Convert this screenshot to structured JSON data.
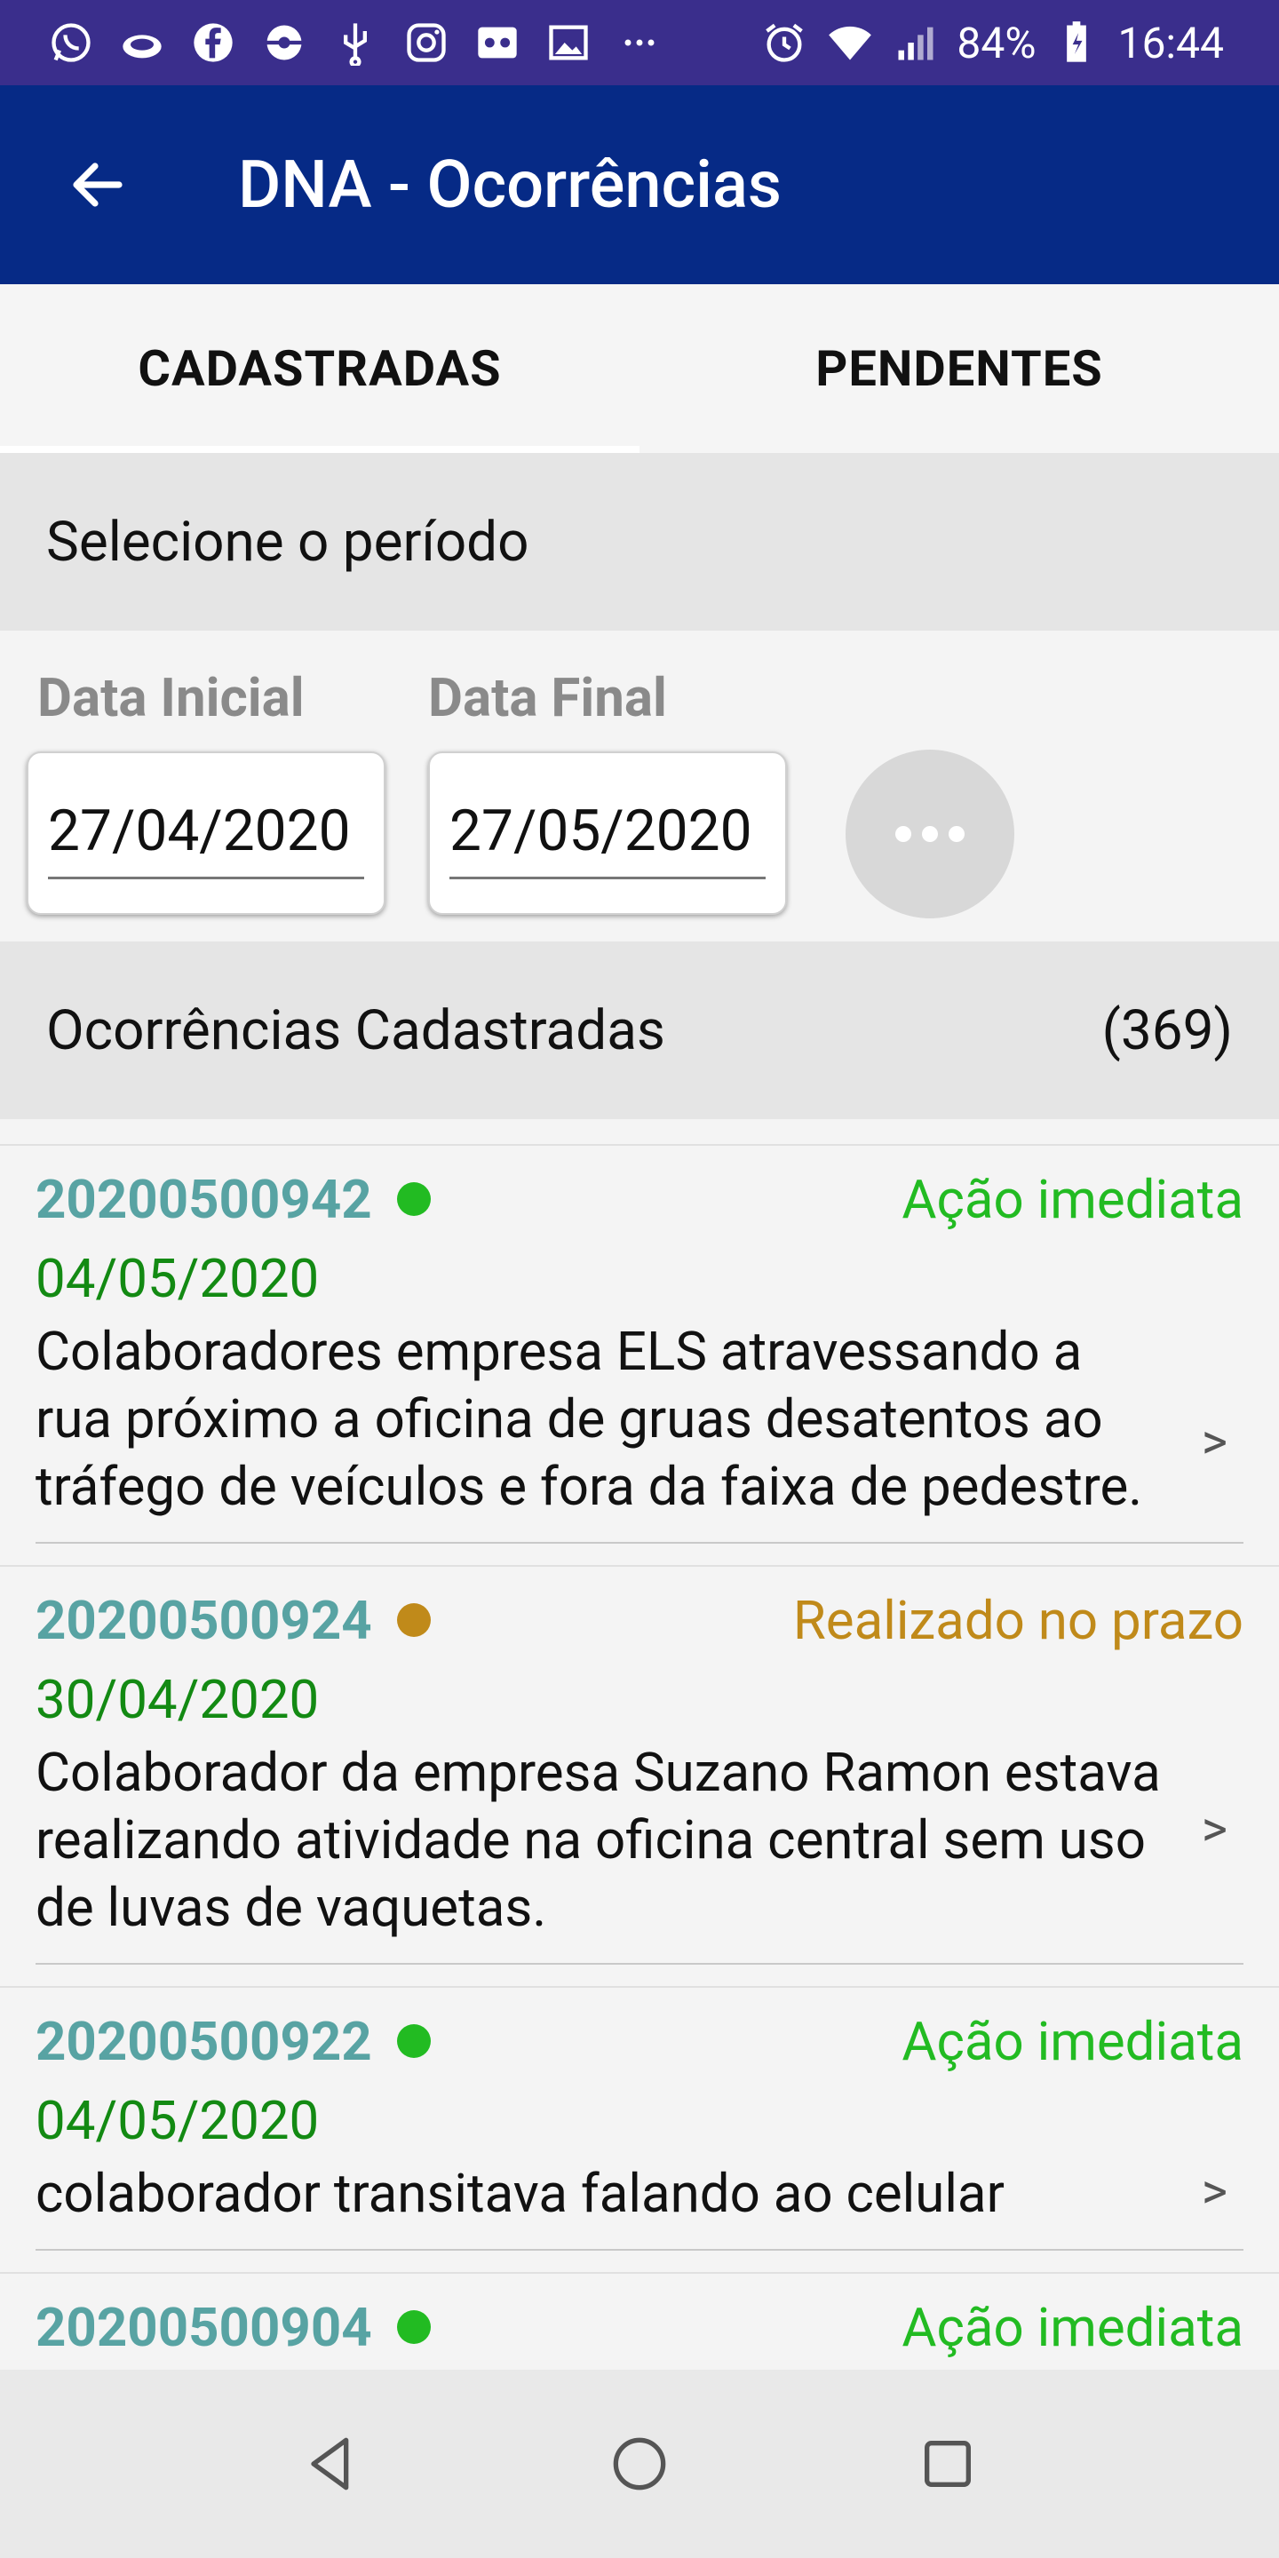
{
  "status_bar": {
    "battery": "84%",
    "time": "16:44",
    "icons_left": [
      "whatsapp-icon",
      "cloud-icon",
      "facebook-icon",
      "pokeball-icon",
      "usb-icon",
      "instagram-icon",
      "voicemail-icon",
      "gallery-icon",
      "more-dots-icon"
    ],
    "icons_right": [
      "alarm-icon",
      "wifi-icon",
      "signal-icon",
      "battery-icon"
    ]
  },
  "app_bar": {
    "title": "DNA - Ocorrências"
  },
  "tabs": [
    {
      "label": "CADASTRADAS",
      "active": true
    },
    {
      "label": "PENDENTES",
      "active": false
    }
  ],
  "period": {
    "header": "Selecione o período",
    "start_label": "Data Inicial",
    "start_value": "27/04/2020",
    "end_label": "Data Final",
    "end_value": "27/05/2020"
  },
  "occurrences": {
    "header": "Ocorrências Cadastradas",
    "count": "(369)",
    "items": [
      {
        "number": "20200500942",
        "status": "Ação imediata",
        "status_color": "#22bb22",
        "date": "04/05/2020",
        "description": "Colaboradores empresa ELS atravessando a rua próximo a oficina de gruas desatentos ao tráfego de veículos e fora da faixa de pedestre."
      },
      {
        "number": "20200500924",
        "status": "Realizado no prazo",
        "status_color": "#c08a1a",
        "date": "30/04/2020",
        "description": "Colaborador da empresa Suzano Ramon estava realizando atividade na oficina central sem uso de luvas de vaquetas."
      },
      {
        "number": "20200500922",
        "status": "Ação imediata",
        "status_color": "#22bb22",
        "date": "04/05/2020",
        "description": "colaborador transitava falando ao celular"
      },
      {
        "number": "20200500904",
        "status": "Ação imediata",
        "status_color": "#22bb22",
        "date": "",
        "description": ""
      }
    ],
    "chevron": ">"
  },
  "nav_bar": {
    "buttons": [
      "back-nav-icon",
      "home-nav-icon",
      "recents-nav-icon"
    ]
  }
}
